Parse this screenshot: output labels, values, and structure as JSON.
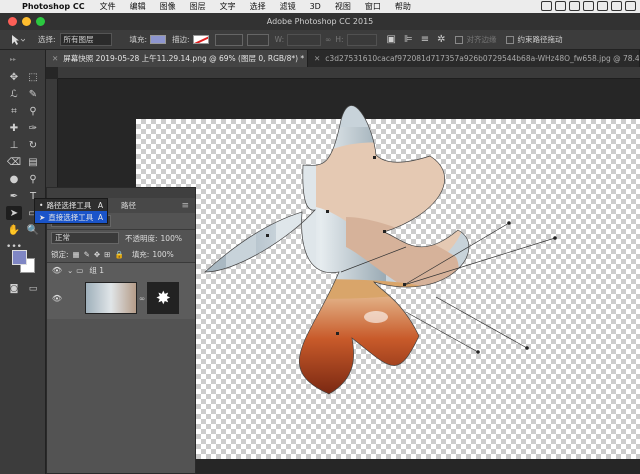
{
  "menubar": {
    "app_name": "Photoshop CC",
    "items": [
      "文件",
      "编辑",
      "图像",
      "图层",
      "文字",
      "选择",
      "滤镜",
      "3D",
      "视图",
      "窗口",
      "帮助"
    ]
  },
  "window": {
    "title": "Adobe Photoshop CC 2015"
  },
  "options": {
    "select_label": "选择:",
    "select_value": "所有图层",
    "fill_label": "填充:",
    "stroke_label": "描边:",
    "w_label": "W:",
    "h_label": "H:",
    "align_edges_label": "对齐边缘",
    "constrain_label": "约束路径拖动",
    "fill_color": "#8e96cf"
  },
  "tabs": [
    {
      "label": "屏幕快照 2019-05-28 上午11.29.14.png @ 69% (图层 0, RGB/8*) *"
    },
    {
      "label": "c3d27531610cacaf972081d717357a926b0729544b68a-WHz48O_fw658.jpg @ 78.4% (图层 0, RGB/8) *"
    }
  ],
  "flyout": {
    "items": [
      {
        "label": "路径选择工具",
        "key": "A"
      },
      {
        "label": "直接选择工具",
        "key": "A"
      }
    ]
  },
  "layers": {
    "tab_label": "路径",
    "blend_mode": "正常",
    "opacity_label": "不透明度:",
    "opacity_value": "100%",
    "lock_label": "锁定:",
    "fill_label": "填充:",
    "fill_value": "100%",
    "group_name": "组 1"
  },
  "colors": {
    "foreground": "#7f86c4",
    "background": "#ffffff"
  }
}
